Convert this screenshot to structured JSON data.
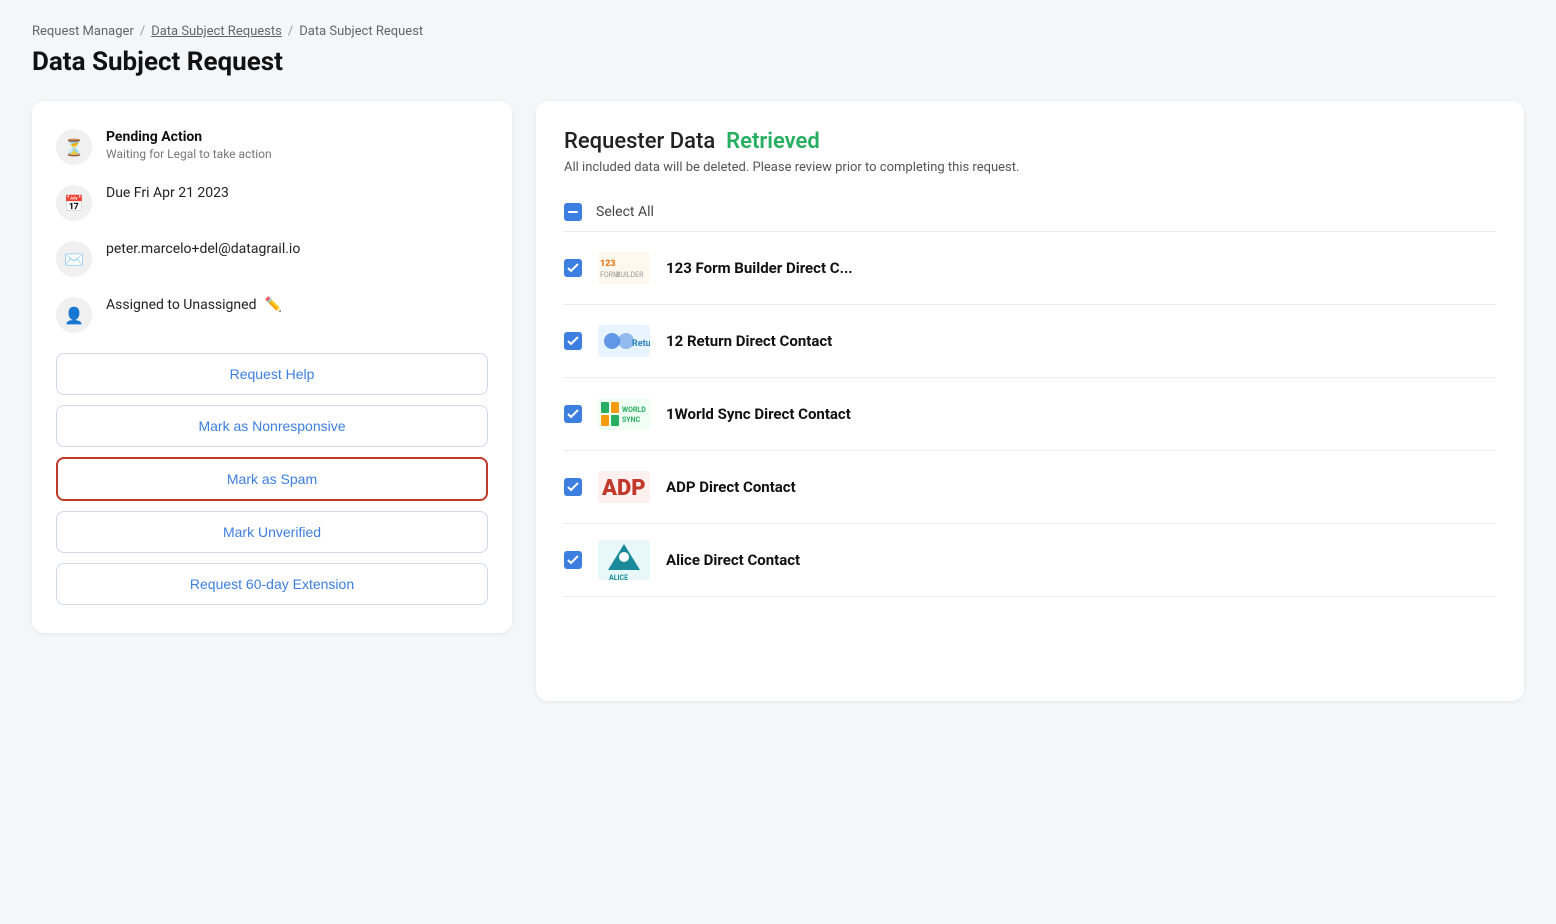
{
  "breadcrumb": {
    "items": [
      {
        "label": "Request Manager",
        "link": false
      },
      {
        "label": "Data Subject Requests",
        "link": true
      },
      {
        "label": "Data Subject Request",
        "link": false
      }
    ]
  },
  "page_title": "Data Subject Request",
  "left_card": {
    "status": {
      "label": "Pending Action",
      "sub": "Waiting for Legal to take action"
    },
    "due_date": "Due Fri Apr 21 2023",
    "email": "peter.marcelo+del@datagrail.io",
    "assigned": "Assigned to Unassigned",
    "buttons": [
      {
        "label": "Request Help",
        "highlighted": false
      },
      {
        "label": "Mark as Nonresponsive",
        "highlighted": false
      },
      {
        "label": "Mark as Spam",
        "highlighted": true
      },
      {
        "label": "Mark Unverified",
        "highlighted": false
      },
      {
        "label": "Request 60-day Extension",
        "highlighted": false
      }
    ]
  },
  "right_panel": {
    "title": "Requester Data",
    "status": "Retrieved",
    "subtitle": "All included data will be deleted. Please review prior to completing this request.",
    "select_all_label": "Select All",
    "items": [
      {
        "name": "123 Form Builder Direct C...",
        "logo_type": "123"
      },
      {
        "name": "12 Return Direct Contact",
        "logo_type": "12return"
      },
      {
        "name": "1World Sync Direct Contact",
        "logo_type": "1world"
      },
      {
        "name": "ADP Direct Contact",
        "logo_type": "adp"
      },
      {
        "name": "Alice Direct Contact",
        "logo_type": "alice"
      }
    ]
  }
}
